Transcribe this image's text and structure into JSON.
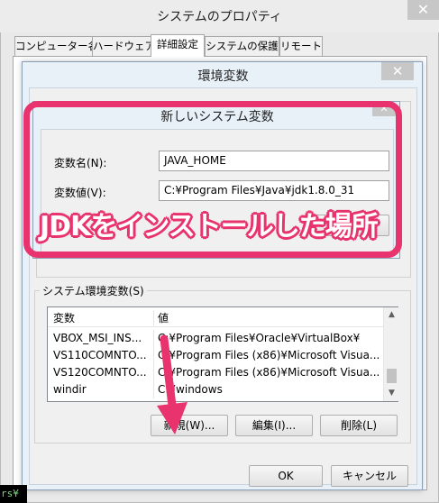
{
  "outer_window": {
    "title": "システムのプロパティ",
    "close_glyph": "✕",
    "tabs": [
      {
        "label": "コンピューター名",
        "active": false
      },
      {
        "label": "ハードウェア",
        "active": false
      },
      {
        "label": "詳細設定",
        "active": true
      },
      {
        "label": "システムの保護",
        "active": false
      },
      {
        "label": "リモート",
        "active": false
      }
    ]
  },
  "env_dialog": {
    "title": "環境変数",
    "close_glyph": "✕",
    "system_vars_label": "システム環境変数(S)",
    "list_headers": {
      "name": "変数",
      "value": "値"
    },
    "rows": [
      {
        "name": "VBOX_MSI_INS...",
        "value": "C:¥Program Files¥Oracle¥VirtualBox¥"
      },
      {
        "name": "VS110COMNTO...",
        "value": "C:¥Program Files (x86)¥Microsoft Visua..."
      },
      {
        "name": "VS120COMNTO...",
        "value": "C:¥Program Files (x86)¥Microsoft Visua..."
      },
      {
        "name": "windir",
        "value": "C:¥windows"
      }
    ],
    "buttons": {
      "new": "新規(W)...",
      "edit": "編集(I)...",
      "delete": "削除(L)"
    },
    "ok": "OK",
    "cancel": "キャンセル"
  },
  "new_var_dialog": {
    "title": "新しいシステム変数",
    "close_glyph": "✕",
    "name_label": "変数名(N):",
    "name_value": "JAVA_HOME",
    "value_label": "変数値(V):",
    "value_value": "C:¥Program Files¥Java¥jdk1.8.0_31"
  },
  "annotation": {
    "text": "JDKをインストールした場所",
    "color": "#e8336e"
  },
  "left_strip_text": "rs¥"
}
